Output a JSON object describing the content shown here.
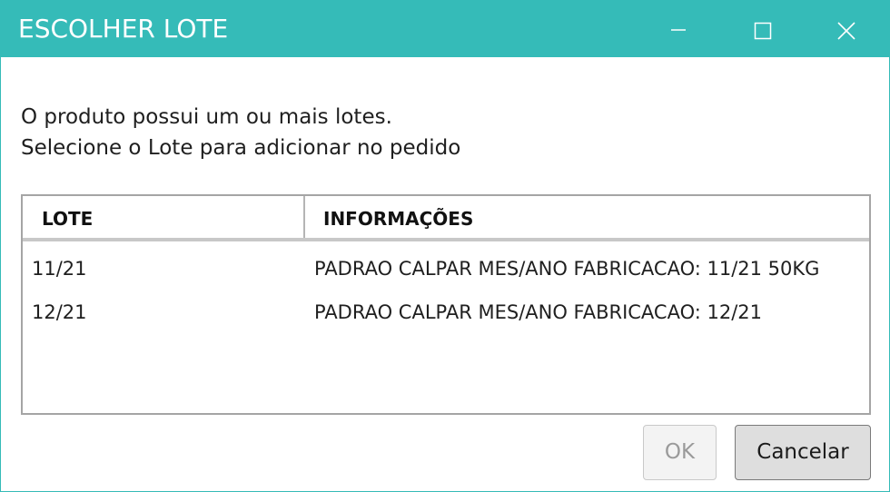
{
  "window": {
    "title": "ESCOLHER LOTE",
    "controls": {
      "minimize_icon": "minimize-icon",
      "maximize_icon": "maximize-icon",
      "close_icon": "close-icon"
    },
    "accent_color": "#35bbb8"
  },
  "message": {
    "line1": "O produto possui um ou mais lotes.",
    "line2": "Selecione o Lote para adicionar no pedido"
  },
  "table": {
    "columns": [
      "LOTE",
      "INFORMAÇÕES"
    ],
    "rows": [
      {
        "lote": "11/21",
        "info": "PADRAO CALPAR MES/ANO FABRICACAO: 11/21 50KG"
      },
      {
        "lote": "12/21",
        "info": "PADRAO CALPAR MES/ANO FABRICACAO: 12/21"
      }
    ]
  },
  "buttons": {
    "ok_label": "OK",
    "ok_enabled": false,
    "cancel_label": "Cancelar"
  }
}
